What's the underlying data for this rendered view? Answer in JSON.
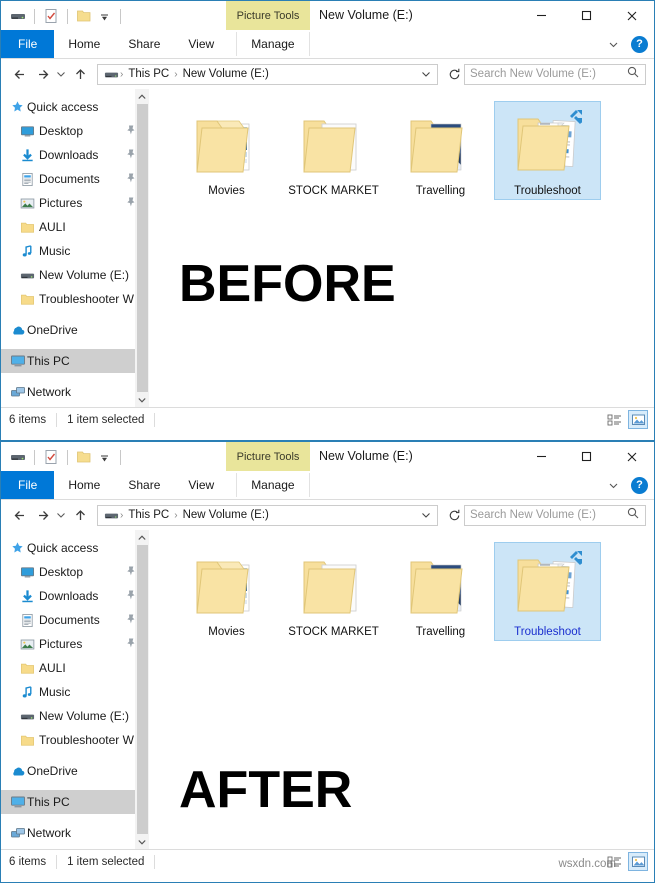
{
  "window": {
    "title": "New Volume (E:)",
    "contextual_tab": "Picture Tools",
    "controls": {
      "minimize": "minimize-icon",
      "maximize": "maximize-icon",
      "close": "close-icon"
    },
    "quick_access": [
      {
        "name": "drive-icon",
        "label": "New Volume (E:)"
      },
      {
        "name": "properties-icon",
        "label": "Properties"
      },
      {
        "name": "new-folder-icon",
        "label": "New folder"
      },
      {
        "name": "customize-dropdown-icon",
        "label": "Customize Quick Access Toolbar"
      }
    ]
  },
  "ribbon": {
    "tabs": [
      {
        "label": "File",
        "selected": true
      },
      {
        "label": "Home",
        "selected": false
      },
      {
        "label": "Share",
        "selected": false
      },
      {
        "label": "View",
        "selected": false
      },
      {
        "label": "Manage",
        "selected": false
      }
    ],
    "collapse_icon": "chevron-down-icon",
    "help_label": "?"
  },
  "address": {
    "back_icon": "arrow-left-icon",
    "forward_icon": "arrow-right-icon",
    "recent_icon": "chevron-down-icon",
    "up_icon": "arrow-up-icon",
    "drive_icon": "drive-icon",
    "crumbs": [
      "This PC",
      "New Volume (E:)"
    ],
    "separator": "›",
    "dropdown_icon": "chevron-down-icon",
    "refresh_icon": "refresh-icon",
    "search_placeholder": "Search New Volume (E:)",
    "search_value": "",
    "search_icon": "search-icon"
  },
  "sidebar": {
    "scroll_up_icon": "chevron-up-icon",
    "scroll_down_icon": "chevron-down-icon",
    "items": [
      {
        "label": "Quick access",
        "icon": "star-pin-icon",
        "indent": false,
        "pinned": false,
        "selected": false
      },
      {
        "label": "Desktop",
        "icon": "desktop-icon",
        "indent": true,
        "pinned": true,
        "selected": false
      },
      {
        "label": "Downloads",
        "icon": "downloads-icon",
        "indent": true,
        "pinned": true,
        "selected": false
      },
      {
        "label": "Documents",
        "icon": "documents-icon",
        "indent": true,
        "pinned": true,
        "selected": false
      },
      {
        "label": "Pictures",
        "icon": "pictures-icon",
        "indent": true,
        "pinned": true,
        "selected": false
      },
      {
        "label": "AULI",
        "icon": "folder-icon",
        "indent": true,
        "pinned": false,
        "selected": false
      },
      {
        "label": "Music",
        "icon": "music-icon",
        "indent": true,
        "pinned": false,
        "selected": false
      },
      {
        "label": "New Volume (E:)",
        "icon": "drive-icon",
        "indent": true,
        "pinned": false,
        "selected": false
      },
      {
        "label": "Troubleshooter W",
        "icon": "folder-icon",
        "indent": true,
        "pinned": false,
        "selected": false
      },
      {
        "label": "OneDrive",
        "icon": "onedrive-icon",
        "indent": false,
        "pinned": false,
        "selected": false
      },
      {
        "label": "This PC",
        "icon": "this-pc-icon",
        "indent": false,
        "pinned": false,
        "selected": true
      },
      {
        "label": "Network",
        "icon": "network-icon",
        "indent": false,
        "pinned": false,
        "selected": false
      }
    ]
  },
  "files": [
    {
      "name": "Movies",
      "icon": "folder-thumb-movies",
      "selected": false
    },
    {
      "name": "STOCK MARKET",
      "icon": "folder-thumb-document",
      "selected": false
    },
    {
      "name": "Travelling",
      "icon": "folder-thumb-winter",
      "selected": false
    },
    {
      "name": "Troubleshoot",
      "icon": "folder-thumb-docs",
      "selected": true
    }
  ],
  "status": {
    "item_count": "6 items",
    "selection": "1 item selected",
    "views": [
      {
        "name": "details-view-icon",
        "active": false
      },
      {
        "name": "large-icons-view-icon",
        "active": true
      }
    ]
  },
  "annotations": {
    "before": "BEFORE",
    "after": "AFTER"
  },
  "watermark": "wsxdn.com",
  "colors": {
    "accent": "#0078d7",
    "contextual_tab": "#e9e59b",
    "selection": "#cce5f7",
    "selection_border": "#9ecdee",
    "folder_yellow": "#f9e08c",
    "window_border": "#2a7fb5"
  }
}
